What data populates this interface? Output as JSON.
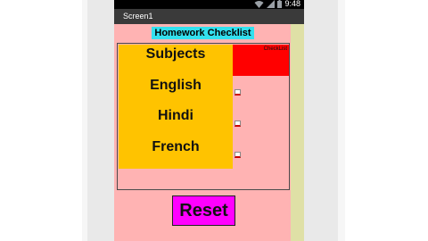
{
  "statusbar": {
    "time": "9:48",
    "icons": [
      "wifi-icon",
      "signal-icon",
      "battery-icon"
    ]
  },
  "titlebar": {
    "title": "Screen1"
  },
  "header": {
    "title": "Homework Checklist"
  },
  "subjects": {
    "heading": "Subjects",
    "items": [
      "English",
      "Hindi",
      "French"
    ]
  },
  "checklist": {
    "label": "CheckList",
    "items": [
      false,
      false,
      false
    ]
  },
  "reset": {
    "label": "Reset"
  },
  "colors": {
    "screen_bg": "#ffb3b3",
    "header_bg": "#33e0ee",
    "subjects_bg": "#ffc300",
    "checklist_bg": "#ff0000",
    "reset_bg": "#ff00ff",
    "side_strip": "#dfe0a6"
  }
}
